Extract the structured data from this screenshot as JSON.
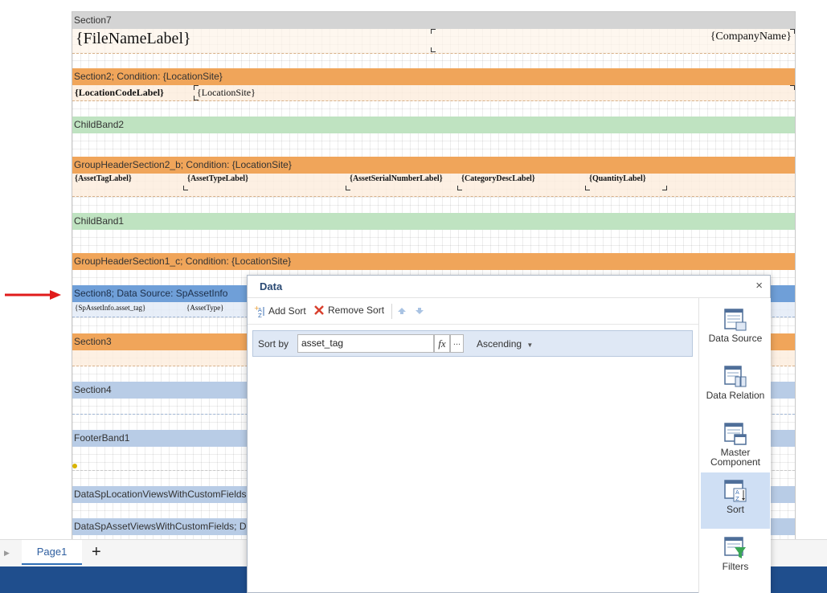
{
  "report": {
    "bands": {
      "section7": "Section7",
      "section2": "Section2; Condition: {LocationSite}",
      "childband2": "ChildBand2",
      "groupheader2b": "GroupHeaderSection2_b; Condition: {LocationSite}",
      "childband1": "ChildBand1",
      "groupheader1c": "GroupHeaderSection1_c; Condition: {LocationSite}",
      "section8": "Section8; Data Source: SpAssetInfo",
      "section3": "Section3",
      "section4": "Section4",
      "footerband1": "FooterBand1",
      "dataloc": "DataSpLocationViewsWithCustomFields;",
      "dataasset": "DataSpAssetViewsWithCustomFields; Da"
    },
    "fields": {
      "filename": "{FileNameLabel}",
      "company": "{CompanyName}",
      "location_code": "{LocationCodeLabel}",
      "location_site": "{LocationSite}",
      "asset_tag": "{AssetTagLabel}",
      "asset_type": "{AssetTypeLabel}",
      "asset_serial": "{AssetSerialNumberLabel}",
      "category": "{CategoryDescLabel}",
      "quantity": "{QuantityLabel}",
      "sp_asset_tag": "{SpAssetInfo.asset_tag}",
      "sp_asset_type": "{AssetType}"
    }
  },
  "tabs": {
    "page1": "Page1",
    "add": "+"
  },
  "dialog": {
    "title": "Data",
    "close": "×",
    "toolbar": {
      "add_sort": "Add Sort",
      "remove_sort": "Remove Sort"
    },
    "sort": {
      "label": "Sort by",
      "value": "asset_tag",
      "fx": "fx",
      "dots": "...",
      "order": "Ascending"
    },
    "side_panel": [
      {
        "label": "Data Source",
        "icon": "data-source-icon"
      },
      {
        "label": "Data Relation",
        "icon": "data-relation-icon"
      },
      {
        "label": "Master Component",
        "icon": "master-component-icon"
      },
      {
        "label": "Sort",
        "icon": "sort-icon",
        "active": true
      },
      {
        "label": "Filters",
        "icon": "filters-icon"
      }
    ]
  },
  "colors": {
    "band_orange": "#f0a55a",
    "band_green": "#bfe3c1",
    "band_blue": "#b8cce6",
    "band_selected": "#6f9fd8",
    "accent": "#1f4e8d",
    "arrow": "#e01b1b"
  }
}
